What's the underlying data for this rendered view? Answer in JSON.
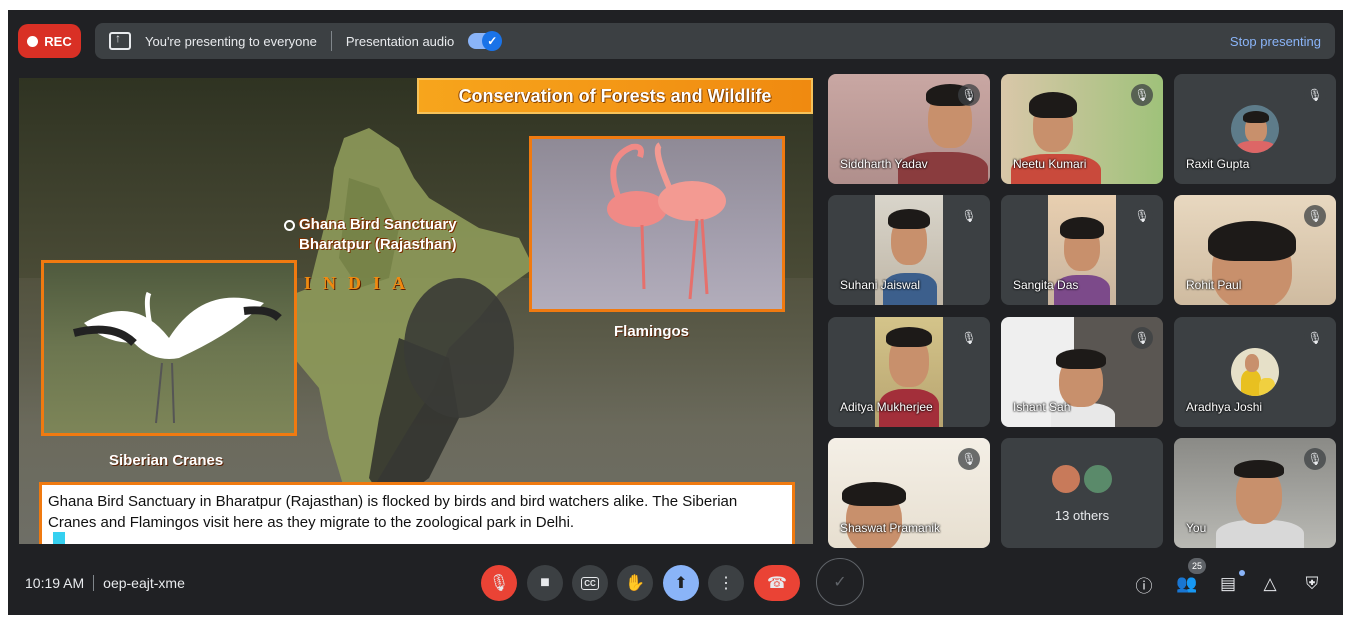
{
  "topbar": {
    "rec_label": "REC",
    "presenting_text": "You're presenting to everyone",
    "presentation_audio_label": "Presentation audio",
    "presentation_audio_on": true,
    "stop_presenting_label": "Stop presenting"
  },
  "slide": {
    "title": "Conservation of  Forests and Wildlife",
    "location_line1": "Ghana Bird Sanctuary",
    "location_line2": "Bharatpur (Rajasthan)",
    "country_label": "INDIA",
    "photo_right_label": "Flamingos",
    "photo_left_label": "Siberian Cranes",
    "caption": "Ghana Bird Sanctuary in Bharatpur (Rajasthan) is flocked by birds and bird watchers alike. The Siberian Cranes and Flamingos visit here as they migrate to the zoological park in Delhi."
  },
  "participants": [
    {
      "name": "Siddharth Yadav",
      "muted": true
    },
    {
      "name": "Neetu Kumari",
      "muted": true
    },
    {
      "name": "Raxit Gupta",
      "muted": true
    },
    {
      "name": "Suhani Jaiswal",
      "muted": true
    },
    {
      "name": "Sangita Das",
      "muted": true
    },
    {
      "name": "Rohit Paul",
      "muted": true
    },
    {
      "name": "Aditya Mukherjee",
      "muted": true
    },
    {
      "name": "Ishant Sah",
      "muted": true
    },
    {
      "name": "Aradhya Joshi",
      "muted": true
    },
    {
      "name": "Shaswat Pramanik",
      "muted": true
    },
    {
      "name": "13 others"
    },
    {
      "name": "You",
      "muted": true
    }
  ],
  "bottombar": {
    "time": "10:19 AM",
    "meeting_code": "oep-eajt-xme",
    "captions_label": "CC",
    "people_count": "25"
  },
  "colors": {
    "background": "#202124",
    "bar": "#3c4043",
    "accent_blue": "#8ab4f8",
    "danger_red": "#ea4335",
    "slide_orange": "#f07a10"
  },
  "icons": [
    "present-screen-icon",
    "mic-off-icon",
    "camera-icon",
    "captions-icon",
    "raise-hand-icon",
    "present-now-icon",
    "more-options-icon",
    "end-call-icon",
    "info-icon",
    "people-icon",
    "chat-icon",
    "activities-icon",
    "host-controls-icon"
  ]
}
